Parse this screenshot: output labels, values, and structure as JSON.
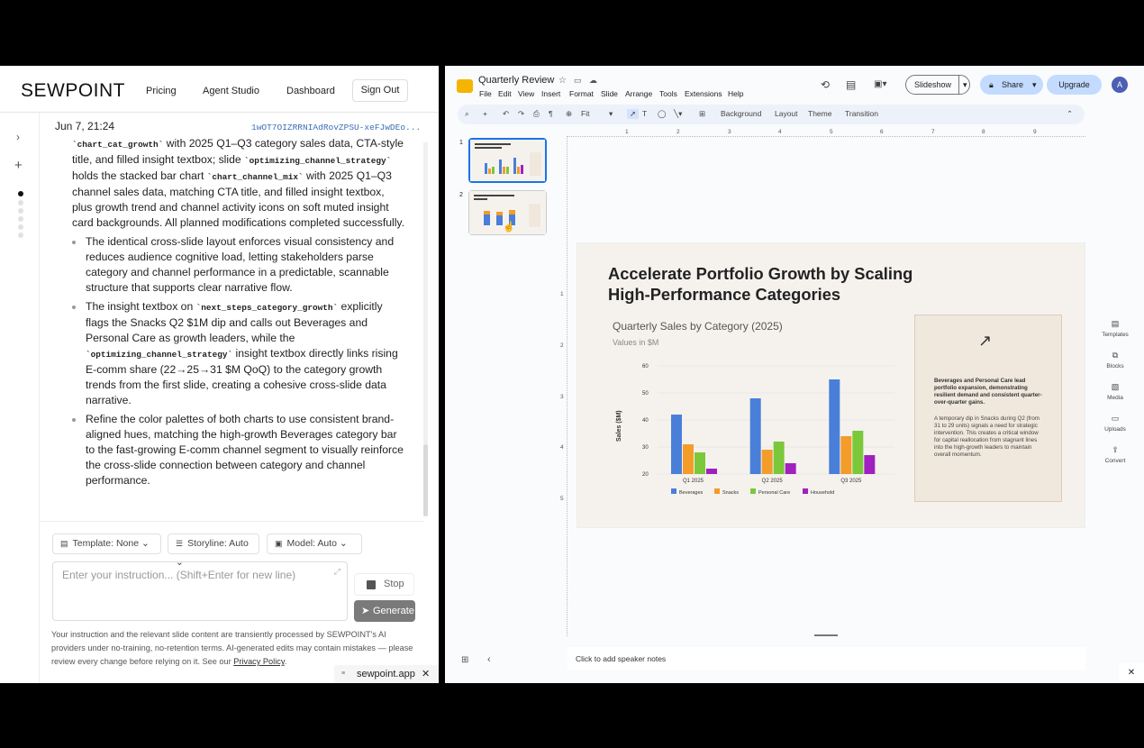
{
  "app": {
    "brand": "SEWPOINT",
    "nav": [
      "Pricing",
      "Agent Studio",
      "Dashboard"
    ],
    "signout": "Sign Out"
  },
  "chat": {
    "date": "Jun 7, 21:24",
    "id": "1wOT7OIZRRNIAdRovZPSU-xeFJwDEo...",
    "p1_parts": [
      "`chart_cat_growth`",
      " with 2025 Q1–Q3 category sales data, CTA-style title, and filled insight textbox; slide ",
      "`optimizing_channel_strategy`",
      " holds the stacked bar chart ",
      "`chart_channel_mix`",
      " with 2025 Q1–Q3 channel sales data, matching CTA title, and filled insight textbox, plus growth trend and channel activity icons on soft muted insight card backgrounds. All planned modifications completed successfully."
    ],
    "b1": "The identical cross-slide layout enforces visual consistency and reduces audience cognitive load, letting stakeholders parse category and channel performance in a predictable, scannable structure that supports clear narrative flow.",
    "b2_parts": [
      "The insight textbox on ",
      "`next_steps_category_growth`",
      " explicitly flags the Snacks Q2 $1M dip and calls out Beverages and Personal Care as growth leaders, while the ",
      "`optimizing_channel_strategy`",
      " insight textbox directly links rising E-comm share (22→25→31 $M QoQ) to the category growth trends from the first slide, creating a cohesive cross-slide data narrative."
    ],
    "b3": "Refine the color palettes of both charts to use consistent brand-aligned hues, matching the high-growth Beverages category bar to the fast-growing E-comm channel segment to visually reinforce the cross-slide connection between category and channel performance."
  },
  "controls": {
    "template": "Template: None",
    "storyline": "Storyline: Auto",
    "model": "Model: Auto",
    "placeholder": "Enter your instruction... (Shift+Enter for new line)",
    "stop": "Stop",
    "generate": "Generate",
    "disclaimer_text": "Your instruction and the relevant slide content are transiently processed by SEWPOINT's AI providers under no-training, no-retention terms. AI-generated edits may contain mistakes — please review every change before relying on it. See our ",
    "privacy": "Privacy Policy",
    "privacy_end": ".",
    "tab_site": "sewpoint.app"
  },
  "doc": {
    "title": "Quarterly Review",
    "menus": [
      "File",
      "Edit",
      "View",
      "Insert",
      "Format",
      "Slide",
      "Arrange",
      "Tools",
      "Extensions",
      "Help"
    ],
    "slideshow": "Slideshow",
    "share": "Share",
    "upgrade": "Upgrade",
    "avatar": "A",
    "zoom": "Fit",
    "tools": [
      "Background",
      "Layout",
      "Theme",
      "Transition"
    ],
    "slide_numbers": [
      "1",
      "2"
    ],
    "ruler_h": [
      "1",
      "2",
      "3",
      "4",
      "5",
      "6",
      "7",
      "8",
      "9"
    ],
    "ruler_v": [
      "1",
      "2",
      "3",
      "4",
      "5"
    ],
    "side_panel": [
      "Templates",
      "Blocks",
      "Media",
      "Uploads",
      "Convert"
    ],
    "notes": "Click to add speaker notes"
  },
  "slide": {
    "title": "Accelerate Portfolio Growth by Scaling High-Performance Categories",
    "insight_bold": "Beverages and Personal Care lead portfolio expansion, demonstrating resilient demand and consistent quarter-over-quarter gains.",
    "insight_body": "A temporary dip in Snacks during Q2 (from 31 to 29 units) signals a need for strategic intervention. This creates a critical window for capital reallocation from stagnant lines into the high-growth leaders to maintain overall momentum."
  },
  "chart_data": {
    "type": "bar",
    "title": "Quarterly Sales by Category (2025)",
    "subtitle": "Values in $M",
    "ylabel": "Sales ($M)",
    "categories": [
      "Q1 2025",
      "Q2 2025",
      "Q3 2025"
    ],
    "ylim": [
      20,
      60
    ],
    "yticks": [
      20,
      30,
      40,
      50,
      60
    ],
    "grid": true,
    "legend": "bottom",
    "series": [
      {
        "name": "Beverages",
        "values": [
          42,
          48,
          55
        ],
        "color": "#4a7fd9"
      },
      {
        "name": "Snacks",
        "values": [
          31,
          29,
          34
        ],
        "color": "#f39c2a"
      },
      {
        "name": "Personal Care",
        "values": [
          28,
          32,
          36
        ],
        "color": "#7bc83a"
      },
      {
        "name": "Household",
        "values": [
          22,
          24,
          27
        ],
        "color": "#a020c0"
      }
    ]
  }
}
